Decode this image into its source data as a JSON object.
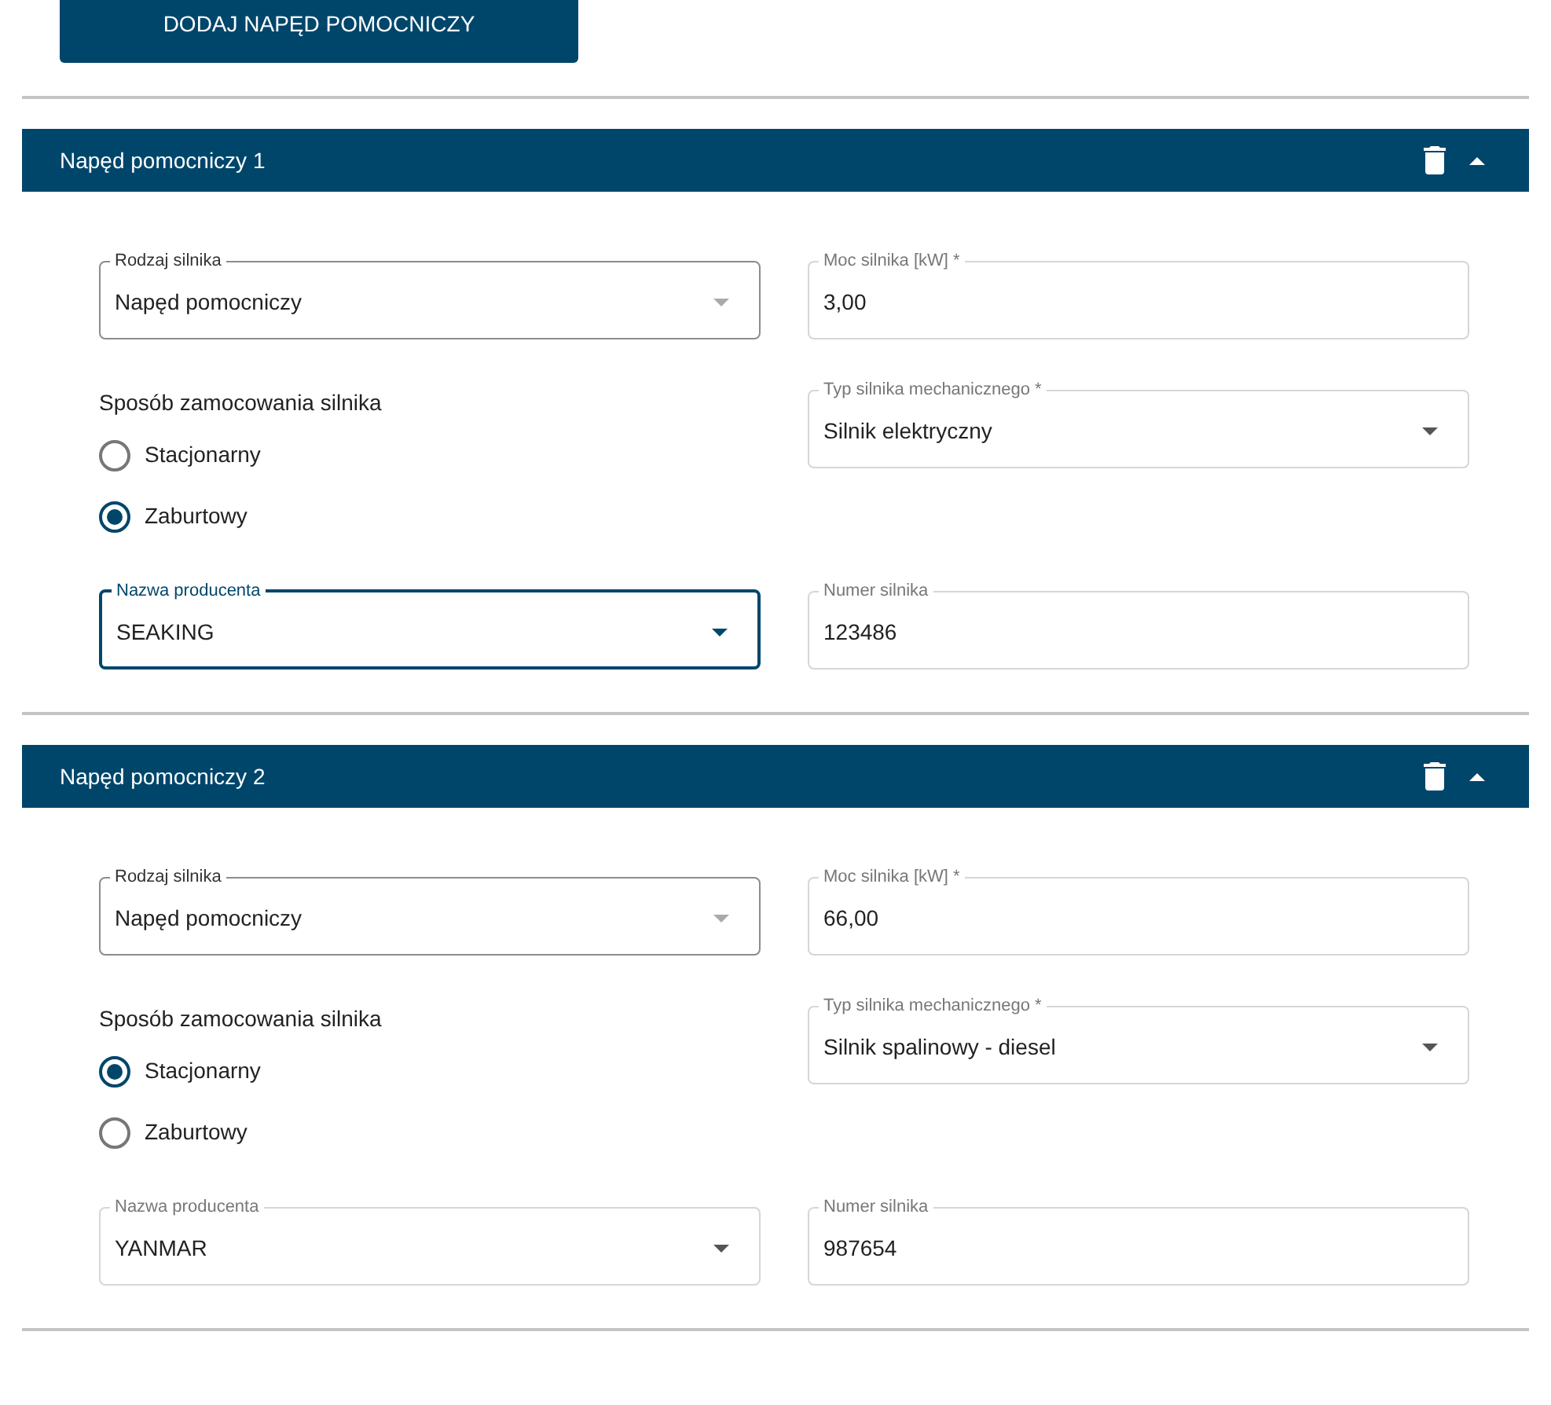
{
  "add_button": "DODAJ NAPĘD POMOCNICZY",
  "sections": [
    {
      "title": "Napęd pomocniczy 1",
      "expanded": true,
      "fields": [
        {
          "kind": "select",
          "label": "Rodzaj silnika",
          "value": "Napęd pomocniczy",
          "readonly": true,
          "focused": false
        },
        {
          "kind": "text",
          "label": "Moc silnika [kW] *",
          "value": "3,00",
          "focused": false
        },
        {
          "kind": "radio_group",
          "label": "Sposób zamocowania silnika",
          "options": [
            {
              "label": "Stacjonarny",
              "selected": false
            },
            {
              "label": "Zaburtowy",
              "selected": true
            }
          ]
        },
        {
          "kind": "select",
          "label": "Typ silnika mechanicznego *",
          "value": "Silnik elektryczny",
          "readonly": false,
          "focused": false
        },
        {
          "kind": "select",
          "label": "Nazwa producenta",
          "value": "SEAKING",
          "readonly": false,
          "focused": true
        },
        {
          "kind": "text",
          "label": "Numer silnika",
          "value": "123486",
          "focused": false
        }
      ]
    },
    {
      "title": "Napęd pomocniczy 2",
      "expanded": true,
      "fields": [
        {
          "kind": "select",
          "label": "Rodzaj silnika",
          "value": "Napęd pomocniczy",
          "readonly": true,
          "focused": false
        },
        {
          "kind": "text",
          "label": "Moc silnika [kW] *",
          "value": "66,00",
          "focused": false
        },
        {
          "kind": "radio_group",
          "label": "Sposób zamocowania silnika",
          "options": [
            {
              "label": "Stacjonarny",
              "selected": true
            },
            {
              "label": "Zaburtowy",
              "selected": false
            }
          ]
        },
        {
          "kind": "select",
          "label": "Typ silnika mechanicznego *",
          "value": "Silnik spalinowy - diesel",
          "readonly": false,
          "focused": false
        },
        {
          "kind": "select",
          "label": "Nazwa producenta",
          "value": "YANMAR",
          "readonly": false,
          "focused": false
        },
        {
          "kind": "text",
          "label": "Numer silnika",
          "value": "987654",
          "focused": false
        }
      ]
    }
  ]
}
